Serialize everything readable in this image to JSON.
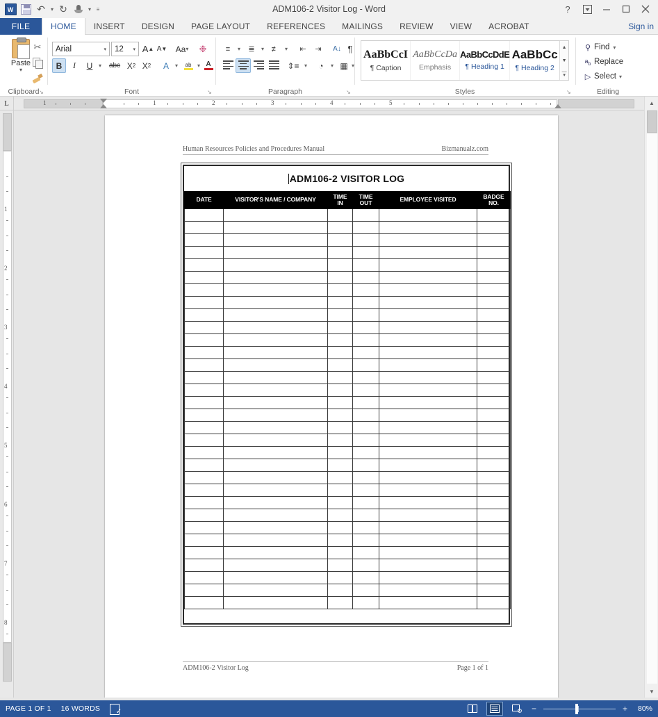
{
  "window": {
    "title": "ADM106-2 Visitor Log - Word",
    "help_icon": "question-mark-icon",
    "ribbon_display_icon": "ribbon-display-options-icon",
    "minimize_icon": "minimize-icon",
    "restore_icon": "restore-icon",
    "close_icon": "close-icon"
  },
  "quick_access": {
    "app_logo": "W",
    "items": [
      {
        "name": "save",
        "icon": "save-icon"
      },
      {
        "name": "undo",
        "icon": "undo-arrow-icon"
      },
      {
        "name": "redo",
        "icon": "redo-arrow-icon"
      },
      {
        "name": "touch-mode",
        "icon": "touch-mouse-mode-icon"
      },
      {
        "name": "customize",
        "icon": "chevron-down-icon"
      }
    ]
  },
  "ribbon": {
    "file_tab": "FILE",
    "tabs": [
      {
        "label": "HOME",
        "active": true
      },
      {
        "label": "INSERT",
        "active": false
      },
      {
        "label": "DESIGN",
        "active": false
      },
      {
        "label": "PAGE LAYOUT",
        "active": false
      },
      {
        "label": "REFERENCES",
        "active": false
      },
      {
        "label": "MAILINGS",
        "active": false
      },
      {
        "label": "REVIEW",
        "active": false
      },
      {
        "label": "VIEW",
        "active": false
      },
      {
        "label": "ACROBAT",
        "active": false
      }
    ],
    "sign_in": "Sign in",
    "collapse_icon": "chevron-up-icon",
    "groups": {
      "clipboard": {
        "label": "Clipboard",
        "paste_label": "Paste",
        "cut_icon": "scissors-icon",
        "copy_icon": "copy-icon",
        "format_painter_icon": "format-painter-icon",
        "dialog_launcher": "↘"
      },
      "font": {
        "label": "Font",
        "font_name": "Arial",
        "font_size": "12",
        "grow_font": "A",
        "shrink_font": "A",
        "change_case": "Aa",
        "clear_formatting_icon": "clear-formatting-icon",
        "bold": "B",
        "italic": "I",
        "underline": "U",
        "strikethrough": "abc",
        "subscript": "X",
        "superscript": "X",
        "text_effects": "A",
        "highlight": "ab",
        "font_color": "A",
        "dialog_launcher": "↘"
      },
      "paragraph": {
        "label": "Paragraph",
        "bullets_icon": "bullet-list-icon",
        "numbering_icon": "numbered-list-icon",
        "multilevel_icon": "multilevel-list-icon",
        "decrease_indent_icon": "decrease-indent-icon",
        "increase_indent_icon": "increase-indent-icon",
        "sort_icon": "sort-az-icon",
        "show_marks": "¶",
        "align_left_icon": "align-left-icon",
        "align_center_icon": "align-center-icon",
        "align_right_icon": "align-right-icon",
        "justify_icon": "justify-icon",
        "line_spacing_icon": "line-spacing-icon",
        "shading_icon": "shading-icon",
        "borders_icon": "borders-icon",
        "dialog_launcher": "↘"
      },
      "styles": {
        "label": "Styles",
        "items": [
          {
            "preview": "AaBbCcI",
            "name": "¶ Caption"
          },
          {
            "preview": "AaBbCcDa",
            "name": "Emphasis"
          },
          {
            "preview": "AaBbCcDdE",
            "name": "¶ Heading 1"
          },
          {
            "preview": "AaBbCc",
            "name": "¶ Heading 2"
          }
        ],
        "scroll_up": "▲",
        "scroll_down": "▼",
        "more": "▾",
        "dialog_launcher": "↘"
      },
      "editing": {
        "label": "Editing",
        "find": "Find",
        "replace": "Replace",
        "select": "Select",
        "find_icon": "binoculars-icon",
        "replace_icon": "replace-icon",
        "select_icon": "cursor-select-icon"
      }
    }
  },
  "ruler": {
    "tab_selector": "L",
    "horizontal_numbers": [
      "1",
      "2",
      "3",
      "4",
      "5"
    ],
    "vertical_numbers": [
      "1",
      "2",
      "3",
      "4",
      "5",
      "6",
      "7",
      "8"
    ]
  },
  "document": {
    "header_left": "Human Resources Policies and Procedures Manual",
    "header_right": "Bizmanualz.com",
    "footer_left": "ADM106-2 Visitor Log",
    "footer_right": "Page 1 of 1",
    "form_title": "ADM106-2 VISITOR LOG",
    "table": {
      "columns": [
        "DATE",
        "VISITOR'S NAME / COMPANY",
        "TIME\nIN",
        "TIME\nOUT",
        "EMPLOYEE VISITED",
        "BADGE\nNO."
      ],
      "row_count": 32,
      "rows": []
    }
  },
  "status_bar": {
    "page": "PAGE 1 OF 1",
    "words": "16 WORDS",
    "proofing_icon": "proofing-errors-icon",
    "views": [
      {
        "name": "read-mode",
        "icon": "read-mode-icon",
        "active": false
      },
      {
        "name": "print-layout",
        "icon": "print-layout-icon",
        "active": true
      },
      {
        "name": "web-layout",
        "icon": "web-layout-icon",
        "active": false
      }
    ],
    "zoom_out": "−",
    "zoom_in": "+",
    "zoom_level": "80%"
  },
  "scrollbar": {
    "up_arrow": "▲",
    "down_arrow": "▼"
  },
  "colors": {
    "accent": "#2b579a",
    "ribbon_bg": "#ffffff",
    "workspace": "#e6e6e6",
    "header_black": "#000000"
  }
}
